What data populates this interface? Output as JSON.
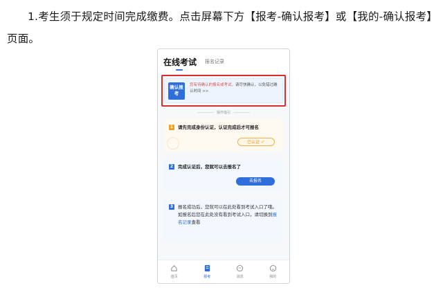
{
  "instruction": {
    "text": "1.考生须于规定时间完成缴费。点击屏幕下方【报考-确认报考】或【我的-确认报考】页面。"
  },
  "app": {
    "title_tab": "在线考试",
    "secondary_tab": "报名记录",
    "confirm_card": {
      "badge": "确认报考",
      "text_highlight": "您有待确认的报名或考试，",
      "text_rest": "请尽快确认，以免错过确认时间 >>"
    },
    "guide_label": "操作指引",
    "steps": [
      {
        "icon": "1",
        "text": "请先完成身份认证，认证完成后才可报名",
        "action": "已认证"
      },
      {
        "icon": "2",
        "text": "完成认证后，您就可以去报名了",
        "action": "去报名"
      },
      {
        "icon": "3",
        "text_before": "报名成功后，您就可以在此处看到考试入口了哦。如报名后您在此处没有看到考试入口，请切换到",
        "link": "报名记录",
        "text_after": "查看"
      }
    ],
    "nav": [
      {
        "label": "首页",
        "icon": "home-icon"
      },
      {
        "label": "报考",
        "icon": "exam-icon"
      },
      {
        "label": "消息",
        "icon": "message-icon"
      },
      {
        "label": "我的",
        "icon": "profile-icon"
      }
    ],
    "colors": {
      "accent": "#2f6fdc",
      "highlight_border": "#d92e2e",
      "warning": "#f0a020"
    }
  }
}
